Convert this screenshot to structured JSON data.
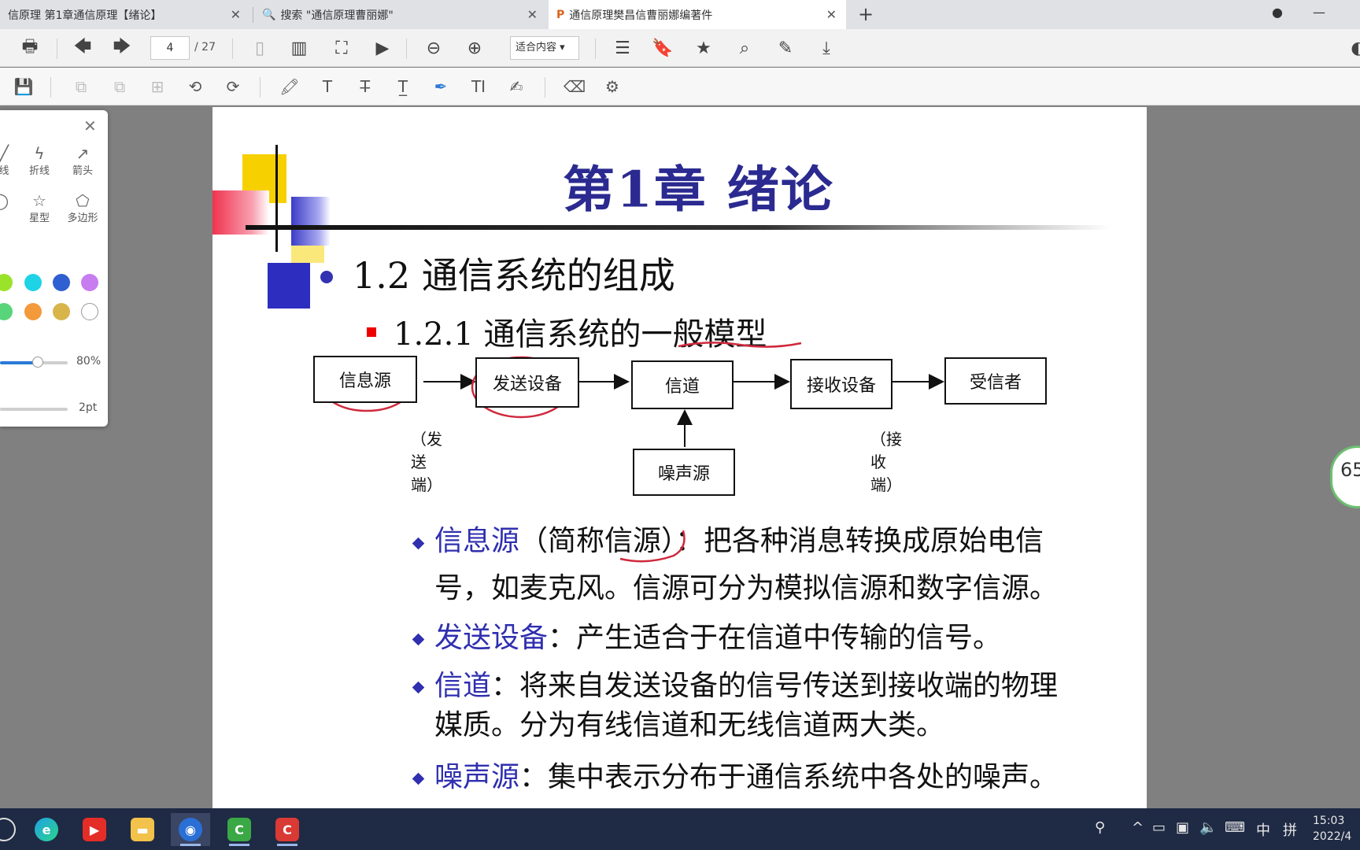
{
  "tabs": [
    {
      "label": "信原理 第1章通信原理【绪论】"
    },
    {
      "label": "搜索 \"通信原理曹丽娜\""
    },
    {
      "label": "通信原理樊昌信曹丽娜编著件"
    }
  ],
  "toolbar": {
    "page_current": "4",
    "page_total": "/ 27",
    "zoom_label": "适合内容 ▾"
  },
  "panel": {
    "tools": [
      {
        "label": "线",
        "icon": "line-icon"
      },
      {
        "label": "折线",
        "icon": "polyline-icon"
      },
      {
        "label": "箭头",
        "icon": "arrow-icon"
      },
      {
        "label": "",
        "icon": "circle-icon"
      },
      {
        "label": "星型",
        "icon": "star-icon"
      },
      {
        "label": "多边形",
        "icon": "polygon-icon"
      }
    ],
    "colors": [
      "#9be22b",
      "#1fd3e6",
      "#2f5fd0",
      "#c77cf0",
      "#58d47a",
      "#f39a3a",
      "#d8b44a",
      "#ffffff"
    ],
    "opacity_label": "80%",
    "opacity_value": 0.8,
    "stroke_label": "2pt"
  },
  "slide": {
    "title": "第1章 绪论",
    "section": "1.2 通信系统的组成",
    "subsection": "1.2.1 通信系统的一般模型",
    "diagram": {
      "source": "信息源",
      "transmitter": "发送设备",
      "channel": "信道",
      "receiver": "接收设备",
      "sink": "受信者",
      "noise": "噪声源",
      "tx_end": "（发送端）",
      "rx_end": "（接收端）"
    },
    "bullets": [
      {
        "term": "信息源",
        "line1": "（简称信源）：把各种消息转换成原始电信",
        "line2": "号，如麦克风。信源可分为模拟信源和数字信源。"
      },
      {
        "term": "发送设备",
        "line1": "：产生适合于在信道中传输的信号。"
      },
      {
        "term": "信道",
        "line1": "：将来自发送设备的信号传送到接收端的物理",
        "line2": "媒质。分为有线信道和无线信道两大类。"
      },
      {
        "term": "噪声源",
        "line1": "：集中表示分布于通信系统中各处的噪声。"
      }
    ]
  },
  "badge": {
    "value": "65"
  },
  "taskbar": {
    "clock_time": "15:03",
    "clock_date": "2022/4",
    "ime_lang": "中",
    "ime_mode": "拼"
  }
}
